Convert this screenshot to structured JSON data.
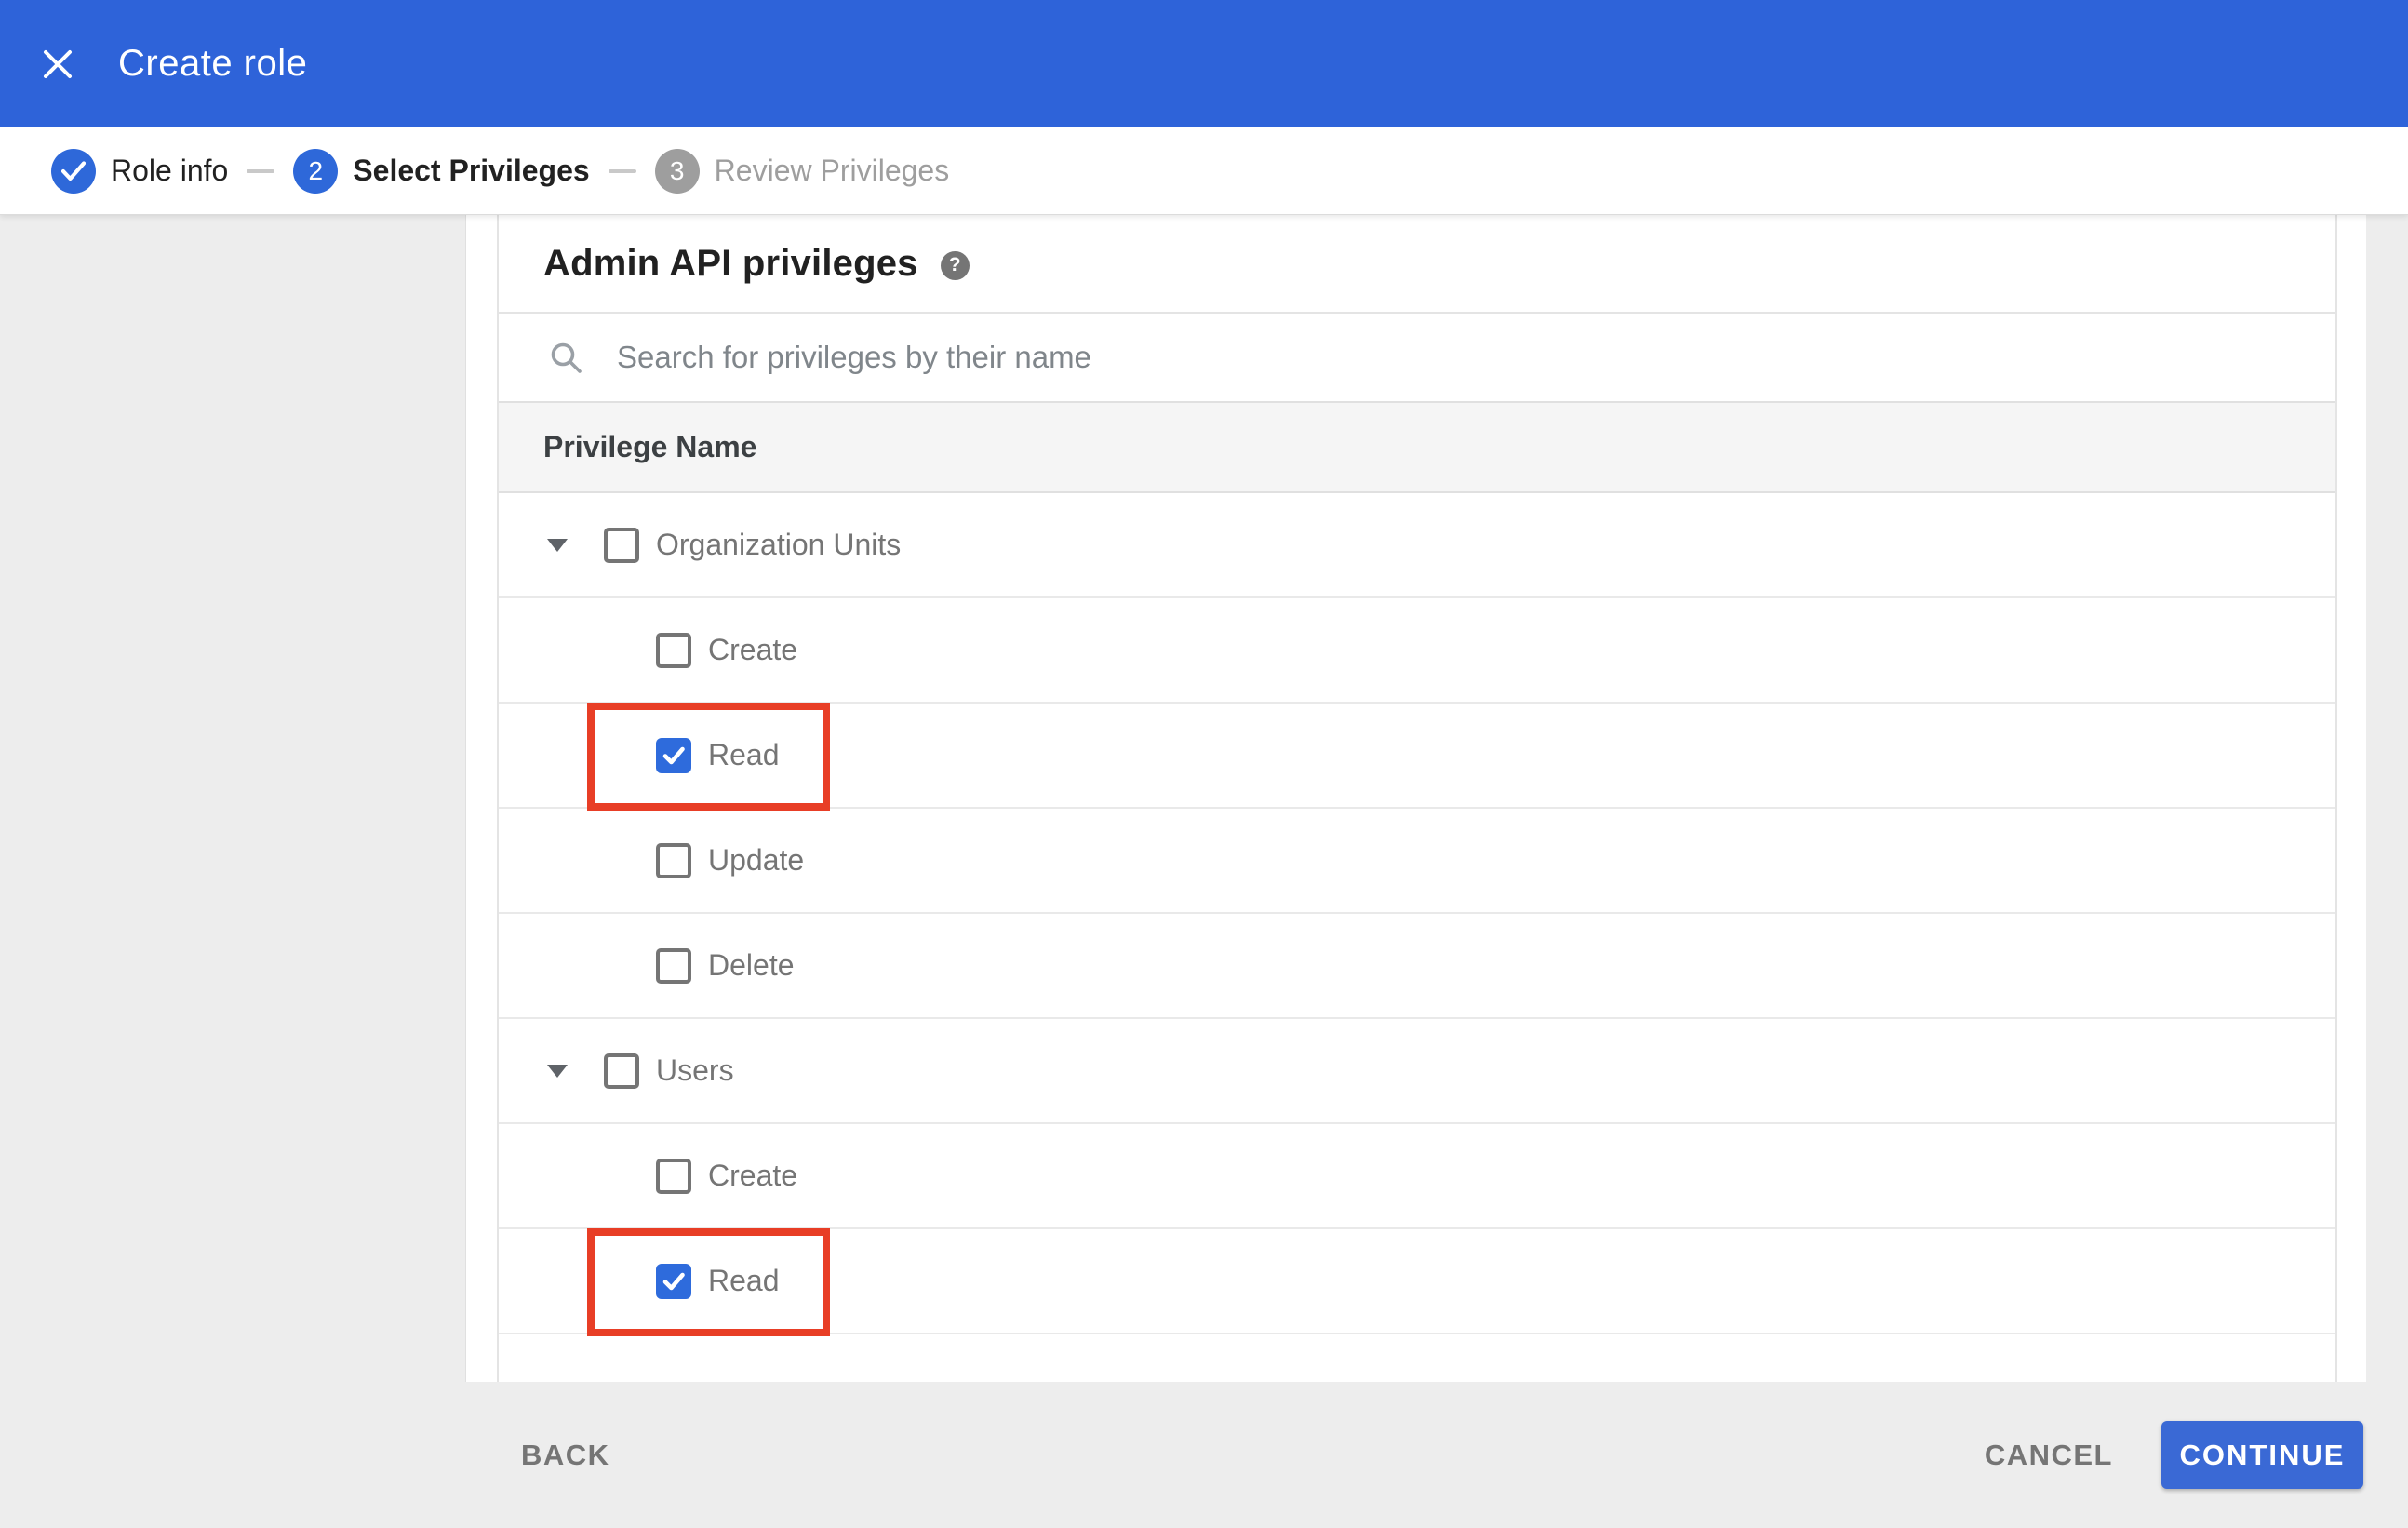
{
  "app": {
    "title": "Create role"
  },
  "stepper": {
    "steps": [
      {
        "label": "Role info",
        "status": "complete",
        "indicator": "checkmark"
      },
      {
        "label": "Select Privileges",
        "status": "active",
        "number": "2"
      },
      {
        "label": "Review Privileges",
        "status": "upcoming",
        "number": "3"
      }
    ]
  },
  "panel": {
    "heading": "Admin API privileges",
    "help_icon": "question-mark-icon",
    "search": {
      "placeholder": "Search for privileges by their name"
    },
    "column_header": "Privilege Name",
    "rows": [
      {
        "label": "Organization Units",
        "type": "parent",
        "expanded": true,
        "checked": false,
        "annotated": false
      },
      {
        "label": "Create",
        "type": "child",
        "checked": false,
        "annotated": false
      },
      {
        "label": "Read",
        "type": "child",
        "checked": true,
        "annotated": true
      },
      {
        "label": "Update",
        "type": "child",
        "checked": false,
        "annotated": false
      },
      {
        "label": "Delete",
        "type": "child",
        "checked": false,
        "annotated": false
      },
      {
        "label": "Users",
        "type": "parent",
        "expanded": true,
        "checked": false,
        "annotated": false
      },
      {
        "label": "Create",
        "type": "child",
        "checked": false,
        "annotated": false
      },
      {
        "label": "Read",
        "type": "child",
        "checked": true,
        "annotated": true
      }
    ]
  },
  "footer": {
    "back_label": "BACK",
    "cancel_label": "CANCEL",
    "continue_label": "CONTINUE"
  },
  "colors": {
    "header_blue": "#2e63d9",
    "accent_blue": "#2e68d9",
    "checkbox_blue": "#2e6bdc",
    "button_blue": "#3a69d5",
    "annotation_red": "#e83e26",
    "inactive_gray": "#9e9e9e",
    "body_gray": "#ededed",
    "table_header_bg": "#f5f5f5"
  }
}
